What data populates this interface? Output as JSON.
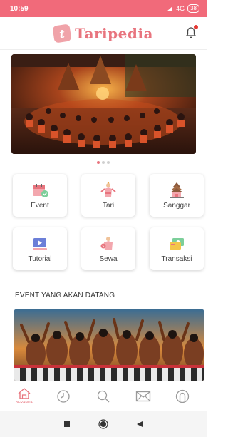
{
  "status_bar": {
    "time": "10:59",
    "network": "4G",
    "battery": "38"
  },
  "header": {
    "app_name": "Taripedia",
    "logo_letter": "t"
  },
  "carousel": {
    "page_count": 3,
    "active_index": 0
  },
  "menu": {
    "items": [
      {
        "label": "Event",
        "icon": "calendar-icon"
      },
      {
        "label": "Tari",
        "icon": "dancer-icon"
      },
      {
        "label": "Sanggar",
        "icon": "temple-icon"
      },
      {
        "label": "Tutorial",
        "icon": "video-tutorial-icon"
      },
      {
        "label": "Sewa",
        "icon": "costume-rental-icon"
      },
      {
        "label": "Transaksi",
        "icon": "transaction-icon"
      }
    ]
  },
  "events_section": {
    "title": "EVENT YANG AKAN DATANG"
  },
  "bottom_nav": {
    "items": [
      {
        "label": "BERANDA",
        "icon": "home-icon",
        "active": true
      },
      {
        "label": "",
        "icon": "clock-icon",
        "active": false
      },
      {
        "label": "",
        "icon": "search-icon",
        "active": false
      },
      {
        "label": "",
        "icon": "mail-icon",
        "active": false
      },
      {
        "label": "",
        "icon": "profile-icon",
        "active": false
      }
    ]
  },
  "colors": {
    "primary": "#f16a7a",
    "brand_text": "#e8747e",
    "inactive_icon": "#9a9a9a"
  }
}
